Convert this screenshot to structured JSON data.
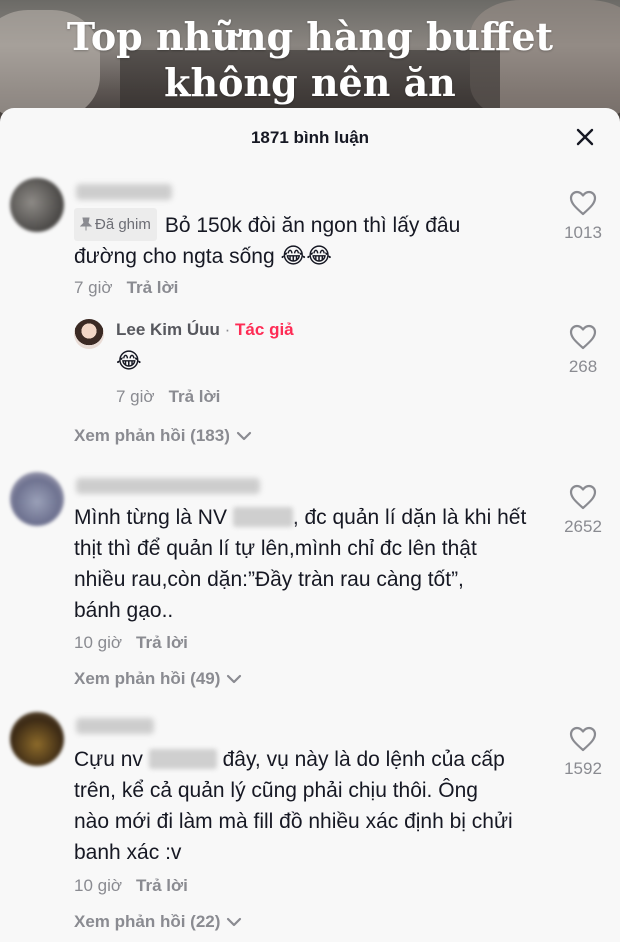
{
  "video": {
    "caption_line1": "Top những hàng buffet",
    "caption_line2": "không nên ăn"
  },
  "header": {
    "comment_count": "1871 bình luận"
  },
  "comments": [
    {
      "pinned_label": "Đã ghim",
      "text_line1": "Bỏ 150k đòi ăn ngon thì lấy đâu",
      "text_line2": "đường cho ngta sống",
      "emoji": "😂😂",
      "time": "7 giờ",
      "reply_label": "Trả lời",
      "likes": "1013",
      "view_replies": "Xem phản hồi (183)",
      "reply": {
        "author": "Lee Kim Úuu",
        "separator": "·",
        "tag": "Tác giả",
        "emoji": "😂",
        "time": "7 giờ",
        "reply_label": "Trả lời",
        "likes": "268"
      }
    },
    {
      "text_line1_a": "Mình từng là NV",
      "text_line1_b": ", đc quản lí dặn là khi hết",
      "text_line2": "thịt thì để quản lí tự lên,mình chỉ đc lên thật",
      "text_line3": "nhiều rau,còn dặn:”Đầy tràn rau càng tốt”,",
      "text_line4": "bánh gạo..",
      "time": "10 giờ",
      "reply_label": "Trả lời",
      "likes": "2652",
      "view_replies": "Xem phản hồi (49)"
    },
    {
      "text_line1_a": "Cựu nv",
      "text_line1_b": "đây, vụ này là do lệnh của cấp",
      "text_line2": "trên, kể cả quản lý cũng phải chịu thôi. Ông",
      "text_line3": "nào mới đi làm mà fill đồ nhiều xác định bị chửi",
      "text_line4": "banh xác :v",
      "time": "10 giờ",
      "reply_label": "Trả lời",
      "likes": "1592",
      "view_replies": "Xem phản hồi (22)"
    }
  ],
  "icons": {
    "close": "close-icon",
    "like": "heart-outline-icon",
    "pin": "pin-icon",
    "chevron": "chevron-down-icon"
  }
}
